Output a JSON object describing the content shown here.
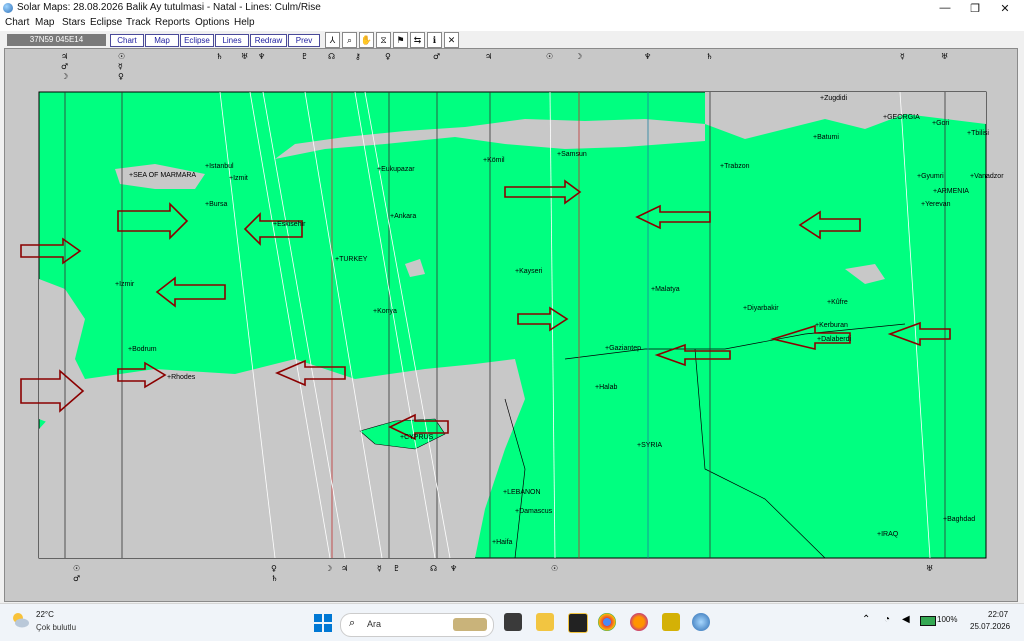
{
  "window": {
    "title": "Solar Maps: 28.08.2026 Balik Ay tutulmasi - Natal - Lines: Culm/Rise",
    "minimize": "—",
    "maximize": "❐",
    "close": "✕"
  },
  "menu": [
    "Chart",
    "Map",
    "Stars",
    "Eclipse",
    "Track",
    "Reports",
    "Options",
    "Help"
  ],
  "toolbar": {
    "coords": "37N59  045E14",
    "buttons": [
      "Chart",
      "Map",
      "Eclipse",
      "Lines",
      "Redraw",
      "Prev"
    ],
    "icons": [
      "compass-icon",
      "zoom-icon",
      "hand-icon",
      "map-icon",
      "flag-icon",
      "arrows-icon",
      "info-icon",
      "cross-icon"
    ]
  },
  "map": {
    "colors": {
      "land": "#00ff80",
      "sea": "#00ff80",
      "frame": "#c8c8c8",
      "arrow": "#8b0000",
      "line_red": "#c03030",
      "line_blue": "#2080a0"
    },
    "places": [
      {
        "name": "Zugdidi"
      },
      {
        "name": "Batumi"
      },
      {
        "name": "GEORGIA"
      },
      {
        "name": "Gori"
      },
      {
        "name": "Tbilisi"
      },
      {
        "name": "Samsun"
      },
      {
        "name": "Trabzon"
      },
      {
        "name": "Kömil"
      },
      {
        "name": "Eukupazar"
      },
      {
        "name": "Istanbul"
      },
      {
        "name": "Izmit"
      },
      {
        "name": "SEA OF MARMARA"
      },
      {
        "name": "Bursa"
      },
      {
        "name": "Eskisehir"
      },
      {
        "name": "Ankara"
      },
      {
        "name": "TURKEY"
      },
      {
        "name": "Kayseri"
      },
      {
        "name": "Malatya"
      },
      {
        "name": "Gyumri"
      },
      {
        "name": "Vanadzor"
      },
      {
        "name": "ARMENIA"
      },
      {
        "name": "Yerevan"
      },
      {
        "name": "Izmir"
      },
      {
        "name": "Konya"
      },
      {
        "name": "Diyarbakir"
      },
      {
        "name": "Kûfre"
      },
      {
        "name": "Kerburan"
      },
      {
        "name": "Dalaberdi"
      },
      {
        "name": "Bodrum"
      },
      {
        "name": "Rhodes"
      },
      {
        "name": "Gaziantep"
      },
      {
        "name": "Halab"
      },
      {
        "name": "CYPRUS"
      },
      {
        "name": "SYRIA"
      },
      {
        "name": "LEBANON"
      },
      {
        "name": "Damascus"
      },
      {
        "name": "Haifa"
      },
      {
        "name": "IRAQ"
      },
      {
        "name": "Baghdad"
      }
    ]
  },
  "taskbar": {
    "weather_temp": "22°C",
    "weather_desc": "Çok bulutlu",
    "search_label": "Ara",
    "battery": "100%",
    "time": "22:07",
    "date": "25.07.2026"
  }
}
